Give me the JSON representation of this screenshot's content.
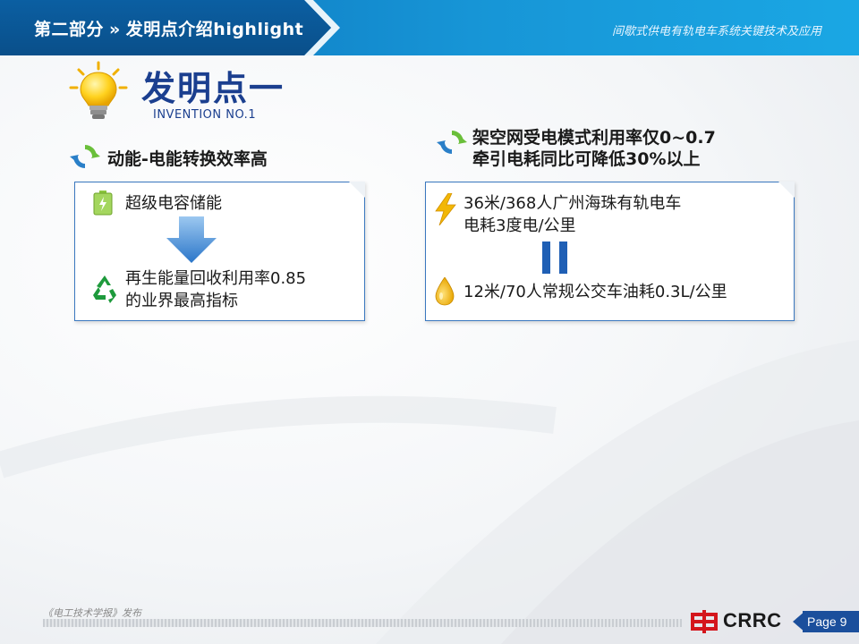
{
  "header": {
    "section_part": "第二部分",
    "section_arrows": "»",
    "section_topic": "发明点介绍highlight",
    "report_title": "间歇式供电有轨电车系统关键技术及应用"
  },
  "invention": {
    "title": "发明点一",
    "subtitle": "INVENTION NO.1"
  },
  "left": {
    "heading": "动能-电能转换效率高",
    "item1": "超级电容储能",
    "item2_line1": "再生能量回收利用率0.85",
    "item2_line2": "的业界最高指标"
  },
  "right": {
    "heading_line1": "架空网受电模式利用率仅0~0.7",
    "heading_line2": "牵引电耗同比可降低30%以上",
    "item1_line1": "36米/368人广州海珠有轨电车",
    "item1_line2": "电耗3度电/公里",
    "item2": "12米/70人常规公交车油耗0.3L/公里"
  },
  "footer": {
    "note": "《电工技术学报》发布",
    "brand": "CRRC",
    "page_label": "Page 9"
  },
  "colors": {
    "header_blue": "#1795d6",
    "title_navy": "#1b3f8f",
    "box_border": "#3a78bf",
    "page_box": "#1b4f9c"
  }
}
